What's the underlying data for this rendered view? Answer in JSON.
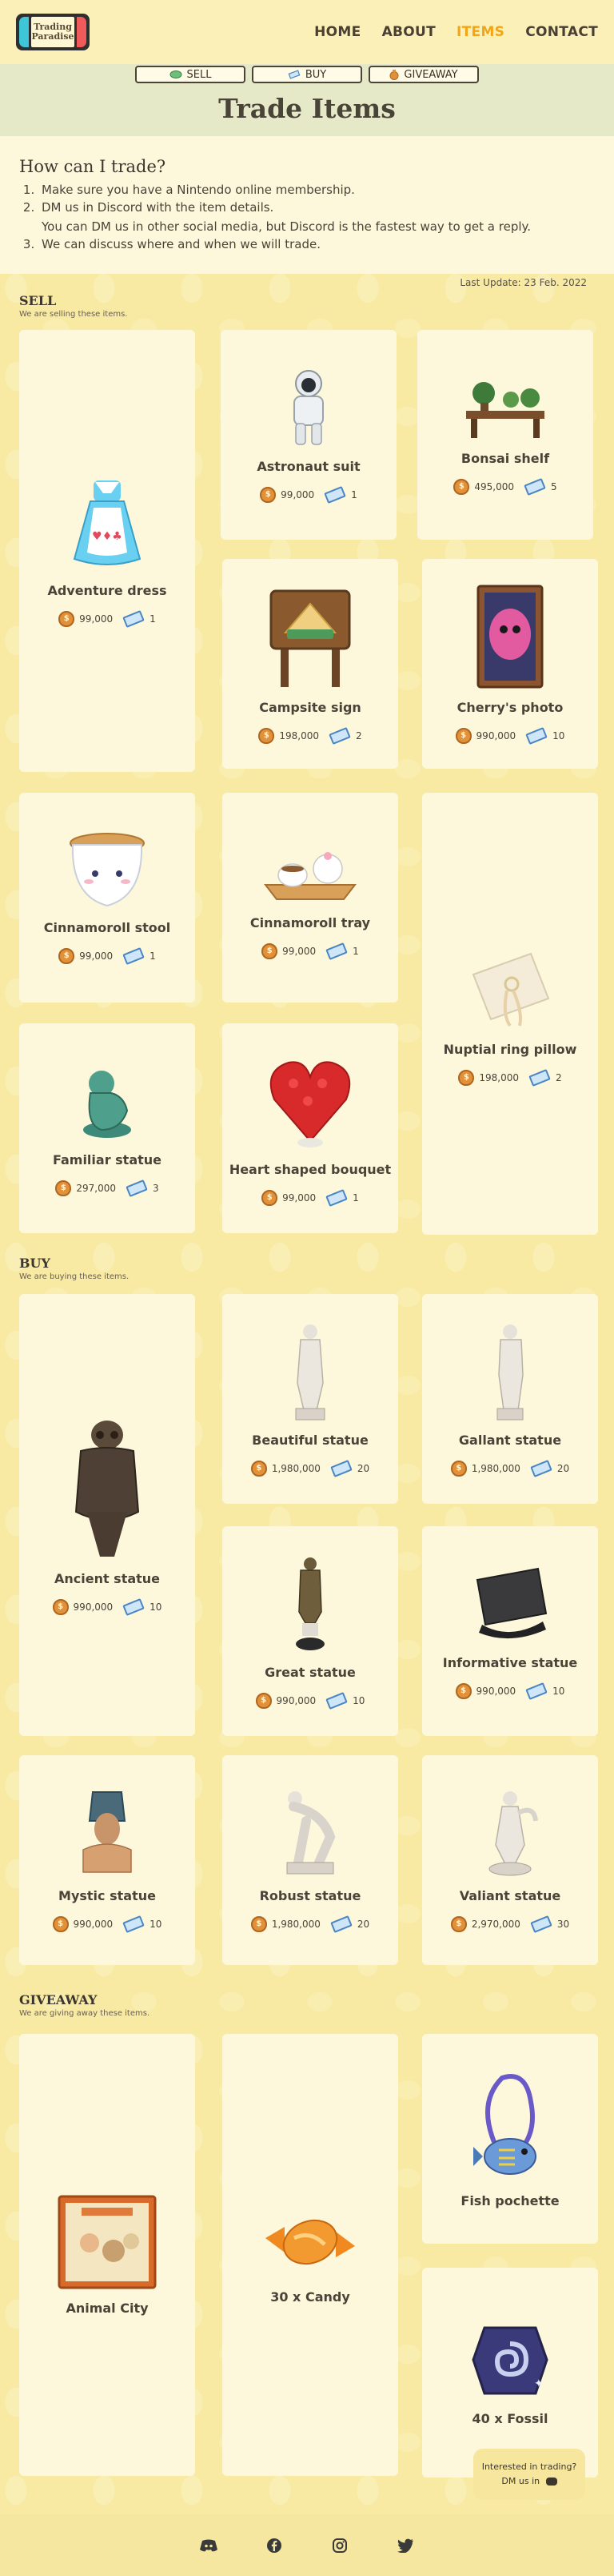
{
  "nav": {
    "logo_line1": "Trading",
    "logo_line2": "Paradise",
    "links": [
      "HOME",
      "ABOUT",
      "ITEMS",
      "CONTACT"
    ],
    "active": "ITEMS"
  },
  "tabs": [
    {
      "label": "SELL",
      "icon": "leaf-icon"
    },
    {
      "label": "BUY",
      "icon": "ticket-icon"
    },
    {
      "label": "GIVEAWAY",
      "icon": "bag-icon"
    }
  ],
  "page_title": "Trade Items",
  "how": {
    "heading": "How can I trade?",
    "steps": [
      "Make sure you have a Nintendo online membership.",
      "DM us in Discord with the item details.",
      "We can discuss where and when we will trade."
    ],
    "step2_sub": "You can DM us in other social media, but Discord is the fastest way to get a reply."
  },
  "last_update": "Last Update: 23 Feb. 2022",
  "sell": {
    "heading": "SELL",
    "desc": "We are selling these items.",
    "items": [
      {
        "name": "Adventure dress",
        "bells": "99,000",
        "tickets": "1"
      },
      {
        "name": "Astronaut suit",
        "bells": "99,000",
        "tickets": "1"
      },
      {
        "name": "Bonsai shelf",
        "bells": "495,000",
        "tickets": "5"
      },
      {
        "name": "Campsite sign",
        "bells": "198,000",
        "tickets": "2"
      },
      {
        "name": "Cherry's photo",
        "bells": "990,000",
        "tickets": "10"
      },
      {
        "name": "Cinnamoroll stool",
        "bells": "99,000",
        "tickets": "1"
      },
      {
        "name": "Cinnamoroll tray",
        "bells": "99,000",
        "tickets": "1"
      },
      {
        "name": "Nuptial ring pillow",
        "bells": "198,000",
        "tickets": "2"
      },
      {
        "name": "Familiar statue",
        "bells": "297,000",
        "tickets": "3"
      },
      {
        "name": "Heart shaped bouquet",
        "bells": "99,000",
        "tickets": "1"
      }
    ]
  },
  "buy": {
    "heading": "BUY",
    "desc": "We are buying these items.",
    "items": [
      {
        "name": "Ancient statue",
        "bells": "990,000",
        "tickets": "10"
      },
      {
        "name": "Beautiful statue",
        "bells": "1,980,000",
        "tickets": "20"
      },
      {
        "name": "Gallant statue",
        "bells": "1,980,000",
        "tickets": "20"
      },
      {
        "name": "Great statue",
        "bells": "990,000",
        "tickets": "10"
      },
      {
        "name": "Informative statue",
        "bells": "990,000",
        "tickets": "10"
      },
      {
        "name": "Mystic statue",
        "bells": "990,000",
        "tickets": "10"
      },
      {
        "name": "Robust statue",
        "bells": "1,980,000",
        "tickets": "20"
      },
      {
        "name": "Valiant statue",
        "bells": "2,970,000",
        "tickets": "30"
      }
    ]
  },
  "giveaway": {
    "heading": "GIVEAWAY",
    "desc": "We are giving away these items.",
    "items": [
      {
        "name": "Animal City"
      },
      {
        "name": "30 x Candy"
      },
      {
        "name": "Fish pochette"
      },
      {
        "name": "40 x Fossil"
      }
    ]
  },
  "chat": {
    "line1": "Interested in trading?",
    "line2": "DM us in"
  },
  "footer_icons": [
    "discord-icon",
    "facebook-icon",
    "instagram-icon",
    "twitter-icon"
  ],
  "colors": {
    "accent": "#f2a516",
    "background": "#f8eaa3",
    "card": "#fdf8dc",
    "text": "#4a4338"
  }
}
